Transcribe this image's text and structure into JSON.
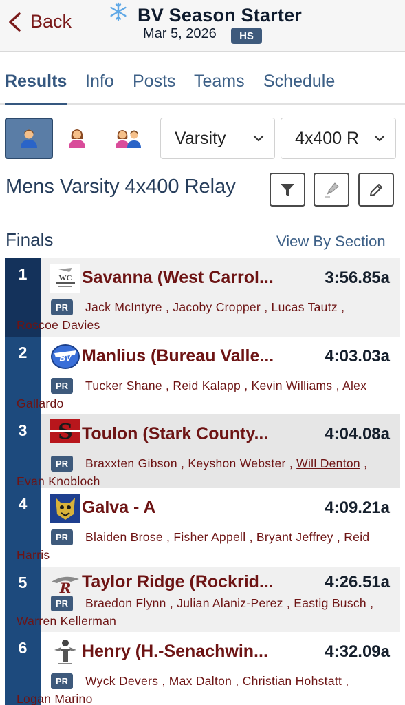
{
  "nav": {
    "back_label": "Back",
    "title": "BV Season Starter",
    "date": "Mar 5, 2026",
    "level_badge": "HS"
  },
  "tabs": [
    {
      "label": "Results",
      "active": true
    },
    {
      "label": "Info"
    },
    {
      "label": "Posts"
    },
    {
      "label": "Teams"
    },
    {
      "label": "Schedule"
    }
  ],
  "filters": {
    "level": "Varsity",
    "event": "4x400 R",
    "gender_selected": "male"
  },
  "event_name": "Mens Varsity 4x400 Relay",
  "section": {
    "title": "Finals",
    "view_link": "View By Section"
  },
  "badge_pr": "PR",
  "results": [
    {
      "place": "1",
      "team": "Savanna (West Carrol...",
      "time": "3:56.85a",
      "athletes_a": "Jack McIntyre , Jacoby Cropper , Lucas Tautz ,",
      "athletes_b": "Roscoe Davies"
    },
    {
      "place": "2",
      "team": "Manlius (Bureau Valle...",
      "time": "4:03.03a",
      "athletes_a": "Tucker Shane , Reid Kalapp , Kevin Williams , Alex",
      "athletes_b": "Gallardo"
    },
    {
      "place": "3",
      "team": "Toulon (Stark County...",
      "time": "4:04.08a",
      "athletes_a": "Braxxten Gibson , Keyshon Webster ,",
      "athletes_link": "Will Denton",
      "athletes_a2": " ,",
      "athletes_b": "Evan Knobloch"
    },
    {
      "place": "4",
      "team": "Galva - A",
      "time": "4:09.21a",
      "athletes_a": "Blaiden Brose , Fisher Appell , Bryant Jeffrey , Reid",
      "athletes_b": "Harris"
    },
    {
      "place": "5",
      "team": "Taylor Ridge (Rockrid...",
      "time": "4:26.51a",
      "athletes_a": "Braedon Flynn , Julian Alaniz-Perez , Eastig Busch ,",
      "athletes_b": "Warren Kellerman"
    },
    {
      "place": "6",
      "team": "Henry (H.-Senachwin...",
      "time": "4:32.09a",
      "athletes_a": "Wyck Devers , Max Dalton , Christian Hohstatt ,",
      "athletes_b": "Logan Marino"
    }
  ],
  "colors": {
    "accent": "#35577f",
    "team_text": "#6d1414",
    "place_bg": "#1d4a7d"
  }
}
